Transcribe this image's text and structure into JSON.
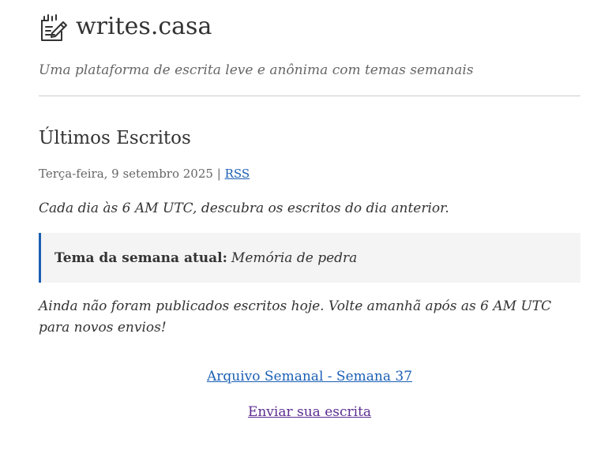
{
  "site": {
    "title": "writes.casa",
    "tagline": "Uma plataforma de escrita leve e anônima com temas semanais",
    "logo_icon": "pencil-notepad-icon"
  },
  "latest": {
    "heading": "Últimos Escritos",
    "date": "Terça-feira, 9 setembro 2025",
    "separator": "|",
    "rss_label": "RSS",
    "intro": "Cada dia às 6 AM UTC, descubra os escritos do dia anterior."
  },
  "theme": {
    "label": "Tema da semana atual:",
    "value": "Memória de pedra"
  },
  "notice": "Ainda não foram publicados escritos hoje. Volte amanhã após as 6 AM UTC para novos envios!",
  "links": {
    "archive": "Arquivo Semanal - Semana 37",
    "submit": "Enviar sua escrita"
  },
  "colors": {
    "link": "#1a5fb4",
    "visited_link": "#5c2d91",
    "theme_accent": "#1a5fb4",
    "theme_background": "#f4f4f4"
  }
}
